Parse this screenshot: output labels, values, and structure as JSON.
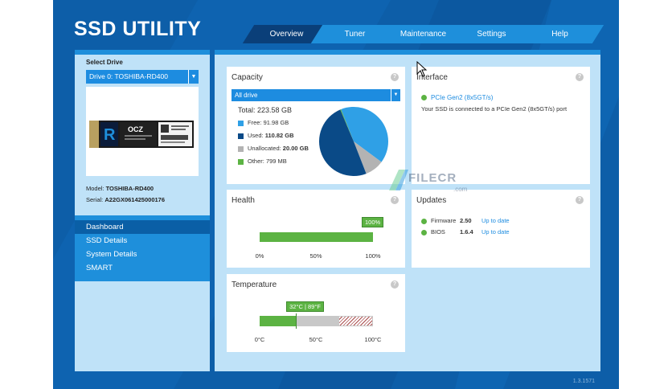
{
  "app": {
    "title": "SSD UTILITY",
    "version": "1.3.1571"
  },
  "nav": {
    "tabs": [
      {
        "label": "Overview",
        "active": true
      },
      {
        "label": "Tuner",
        "active": false
      },
      {
        "label": "Maintenance",
        "active": false
      },
      {
        "label": "Settings",
        "active": false
      },
      {
        "label": "Help",
        "active": false
      }
    ]
  },
  "sidebar": {
    "select_label": "Select Drive",
    "drive_selected": "Drive 0: TOSHIBA-RD400",
    "model_label": "Model:",
    "model_value": "TOSHIBA-RD400",
    "serial_label": "Serial:",
    "serial_value": "A22GX061425000176",
    "items": [
      "Dashboard",
      "SSD Details",
      "System Details",
      "SMART"
    ],
    "active_item": "Dashboard"
  },
  "capacity": {
    "title": "Capacity",
    "filter": "All drive",
    "total": "Total: 223.58 GB",
    "legend": [
      {
        "label": "Free:",
        "value": "91.98 GB",
        "color": "#2fa0e6"
      },
      {
        "label": "Used:",
        "value": "110.82 GB",
        "color": "#0a4a87"
      },
      {
        "label": "Unallocated:",
        "value": "20.00 GB",
        "color": "#b3b3b3"
      },
      {
        "label": "Other:",
        "value": "799 MB",
        "color": "#5cb343"
      }
    ]
  },
  "interface": {
    "title": "Interface",
    "status": "PCIe Gen2 (8x5GT/s)",
    "description": "Your SSD is connected to a PCIe Gen2 (8x5GT/s) port"
  },
  "health": {
    "title": "Health",
    "value_label": "100%",
    "value": 1.0,
    "ticks": [
      "0%",
      "50%",
      "100%"
    ]
  },
  "updates": {
    "title": "Updates",
    "rows": [
      {
        "name": "Firmware",
        "version": "2.50",
        "status": "Up to date"
      },
      {
        "name": "BIOS",
        "version": "1.6.4",
        "status": "Up to date"
      }
    ]
  },
  "temperature": {
    "title": "Temperature",
    "value_label": "32°C | 89°F",
    "value_c": 32,
    "ticks": [
      "0°C",
      "50°C",
      "100°C"
    ]
  },
  "watermark": {
    "text": "FILECR",
    "sub": ".com"
  },
  "colors": {
    "app_bg": "#0d5ea8",
    "accent": "#1e8fdb",
    "panel_bg": "#bfe2f8",
    "good": "#5cb343"
  }
}
